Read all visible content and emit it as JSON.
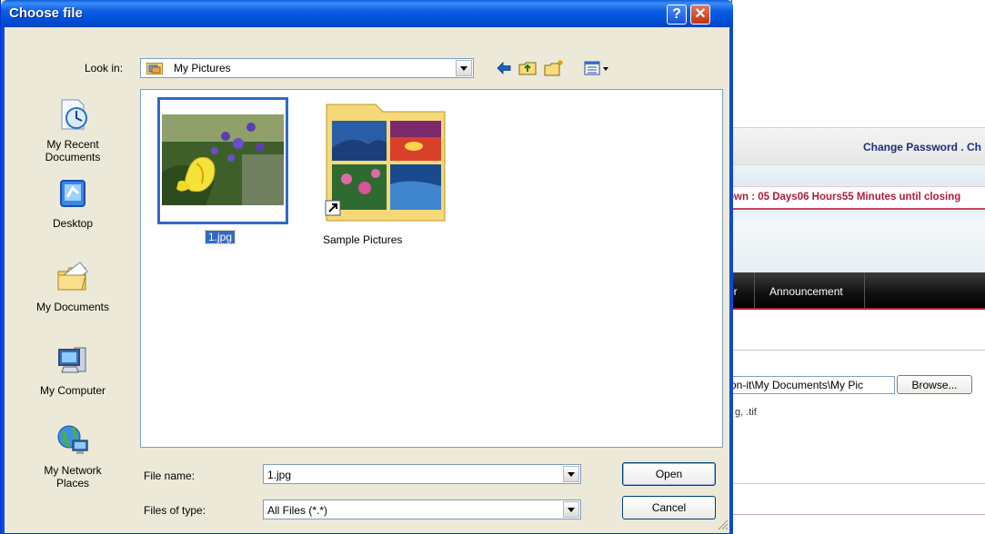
{
  "dialog": {
    "title": "Choose file",
    "help_icon": "question-mark-icon",
    "close_icon": "close-x-icon",
    "look_in_label": "Look in:",
    "look_in_value": "My Pictures",
    "toolbar": [
      "back-arrow-icon",
      "up-folder-icon",
      "new-folder-icon",
      "view-menu-icon"
    ],
    "places": [
      {
        "label": "My Recent\nDocuments",
        "icon": "recent-documents-icon"
      },
      {
        "label": "Desktop",
        "icon": "desktop-icon"
      },
      {
        "label": "My Documents",
        "icon": "my-documents-icon"
      },
      {
        "label": "My Computer",
        "icon": "my-computer-icon"
      },
      {
        "label": "My Network\nPlaces",
        "icon": "network-places-icon"
      }
    ],
    "files": [
      {
        "name": "1.jpg",
        "selected": true,
        "icon": "flower-photo-thumbnail"
      },
      {
        "name": "Sample Pictures",
        "selected": false,
        "icon": "folder-shortcut-thumbnail"
      }
    ],
    "file_name_label": "File name:",
    "file_name_value": "1.jpg",
    "file_type_label": "Files of type:",
    "file_type_value": "All Files (*.*)",
    "open_label": "Open",
    "cancel_label": "Cancel"
  },
  "webpage": {
    "top_links": "Change Password . Ch",
    "countdown": "own : 05 Days06 Hours55 Minutes until closing",
    "nav_items": [
      "er",
      "Announcement"
    ],
    "path_value": "on-it\\My Documents\\My Pic",
    "browse_label": "Browse...",
    "extensions": "g, .tif"
  },
  "colors": {
    "titlebar": "#0054e3",
    "dialog_bg": "#ece9d8",
    "selection": "#316ac5",
    "countdown_text": "#b01d36",
    "nav_bg": "#111111"
  }
}
